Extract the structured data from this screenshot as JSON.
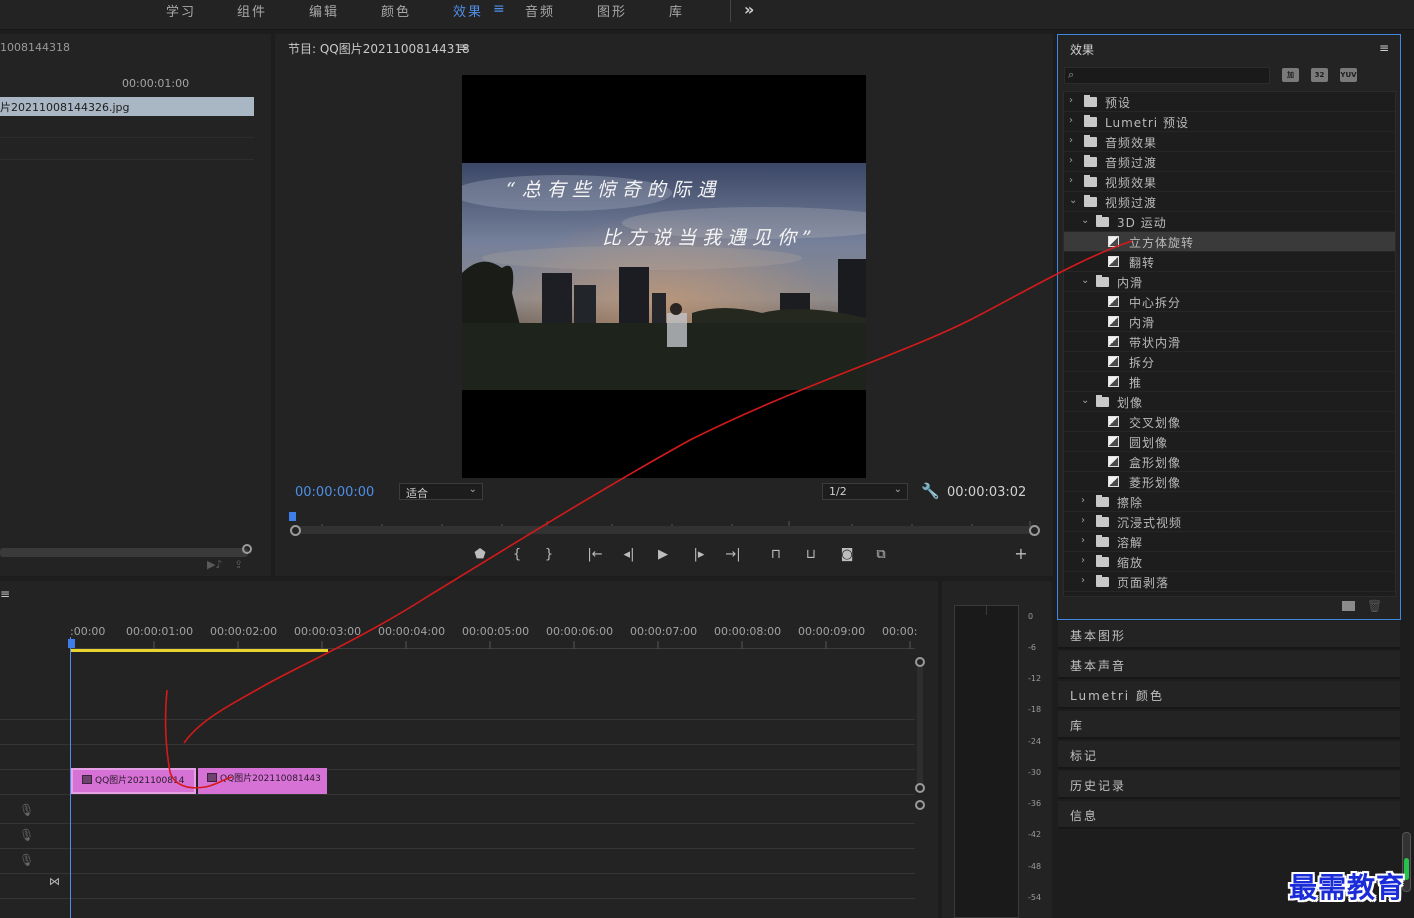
{
  "workspace": {
    "tabs": [
      {
        "label": "学习"
      },
      {
        "label": "组件"
      },
      {
        "label": "编辑"
      },
      {
        "label": "颜色"
      },
      {
        "label": "效果"
      },
      {
        "label": "音频"
      },
      {
        "label": "图形"
      },
      {
        "label": "库"
      }
    ],
    "active_tab": "效果",
    "menu_glyph": "≡",
    "more_glyph": "»"
  },
  "source": {
    "title": "1008144318",
    "timecode": "00:00:01:00",
    "clip_label": "片20211008144326.jpg"
  },
  "program": {
    "title": "节目: QQ图片20211008144318",
    "menu_glyph": "≡",
    "overlay_line1": "“总有些惊奇的际遇",
    "overlay_line2": "比方说当我遇见你”",
    "current_timecode": "00:00:00:00",
    "zoom_select": "适合",
    "resolution_select": "1/2",
    "duration": "00:00:03:02",
    "add_glyph": "+"
  },
  "timeline": {
    "menu_glyph": "≡",
    "ruler": [
      ":00:00",
      "00:00:01:00",
      "00:00:02:00",
      "00:00:03:00",
      "00:00:04:00",
      "00:00:05:00",
      "00:00:06:00",
      "00:00:07:00",
      "00:00:08:00",
      "00:00:09:00",
      "00:00:"
    ],
    "clips": [
      {
        "label": "QQ图片2021100814"
      },
      {
        "label": "QQ图片202110081443"
      }
    ]
  },
  "meter": {
    "db_labels": [
      "0",
      "-6",
      "-12",
      "-18",
      "-24",
      "-30",
      "-36",
      "-42",
      "-48",
      "-54"
    ]
  },
  "effects": {
    "title": "效果",
    "menu_glyph": "≡",
    "buttons": [
      "加",
      "32",
      "YUV"
    ],
    "tree": [
      {
        "label": "预设",
        "level": 0,
        "kind": "folder",
        "expanded": false
      },
      {
        "label": "Lumetri 预设",
        "level": 0,
        "kind": "folder",
        "expanded": false
      },
      {
        "label": "音频效果",
        "level": 0,
        "kind": "folder",
        "expanded": false
      },
      {
        "label": "音频过渡",
        "level": 0,
        "kind": "folder",
        "expanded": false
      },
      {
        "label": "视频效果",
        "level": 0,
        "kind": "folder",
        "expanded": false
      },
      {
        "label": "视频过渡",
        "level": 0,
        "kind": "folder",
        "expanded": true
      },
      {
        "label": "3D 运动",
        "level": 1,
        "kind": "folder",
        "expanded": true
      },
      {
        "label": "立方体旋转",
        "level": 2,
        "kind": "item",
        "selected": true
      },
      {
        "label": "翻转",
        "level": 2,
        "kind": "item"
      },
      {
        "label": "内滑",
        "level": 1,
        "kind": "folder",
        "expanded": true
      },
      {
        "label": "中心拆分",
        "level": 2,
        "kind": "item"
      },
      {
        "label": "内滑",
        "level": 2,
        "kind": "item"
      },
      {
        "label": "带状内滑",
        "level": 2,
        "kind": "item"
      },
      {
        "label": "拆分",
        "level": 2,
        "kind": "item"
      },
      {
        "label": "推",
        "level": 2,
        "kind": "item"
      },
      {
        "label": "划像",
        "level": 1,
        "kind": "folder",
        "expanded": true
      },
      {
        "label": "交叉划像",
        "level": 2,
        "kind": "item"
      },
      {
        "label": "圆划像",
        "level": 2,
        "kind": "item"
      },
      {
        "label": "盒形划像",
        "level": 2,
        "kind": "item"
      },
      {
        "label": "菱形划像",
        "level": 2,
        "kind": "item"
      },
      {
        "label": "擦除",
        "level": 1,
        "kind": "folder",
        "expanded": false
      },
      {
        "label": "沉浸式视频",
        "level": 1,
        "kind": "folder",
        "expanded": false
      },
      {
        "label": "溶解",
        "level": 1,
        "kind": "folder",
        "expanded": false
      },
      {
        "label": "缩放",
        "level": 1,
        "kind": "folder",
        "expanded": false
      },
      {
        "label": "页面剥落",
        "level": 1,
        "kind": "folder",
        "expanded": false
      }
    ]
  },
  "collapsed_panels": [
    {
      "label": "基本图形"
    },
    {
      "label": "基本声音"
    },
    {
      "label": "Lumetri 颜色"
    },
    {
      "label": "库"
    },
    {
      "label": "标记"
    },
    {
      "label": "历史记录"
    },
    {
      "label": "信息"
    }
  ],
  "watermark": "最需教育",
  "colors": {
    "accent": "#4f8fe6",
    "clip": "#d671d6",
    "work_area": "#e9d42e",
    "annotation": "#d41a1a"
  }
}
